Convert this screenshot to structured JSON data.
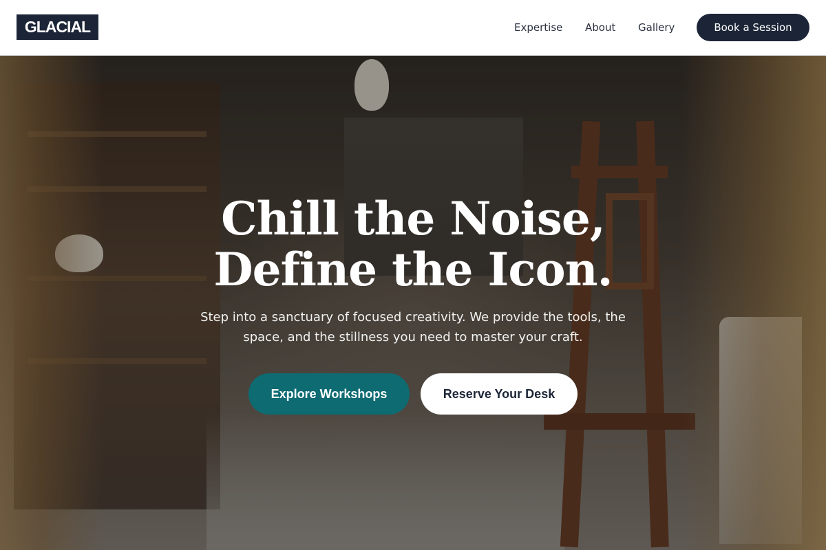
{
  "header": {
    "logo": "GLACIAL",
    "nav": {
      "expertise": "Expertise",
      "about": "About",
      "gallery": "Gallery"
    },
    "cta_label": "Book a Session"
  },
  "hero": {
    "title_line1": "Chill the Noise,",
    "title_line2": "Define the Icon.",
    "subtitle": "Step into a sanctuary of focused creativity. We provide the tools, the space, and the stillness you need to master your craft.",
    "primary_button": "Explore Workshops",
    "secondary_button": "Reserve Your Desk"
  },
  "colors": {
    "brand_dark": "#1c2537",
    "accent_teal": "#0e6b72"
  }
}
